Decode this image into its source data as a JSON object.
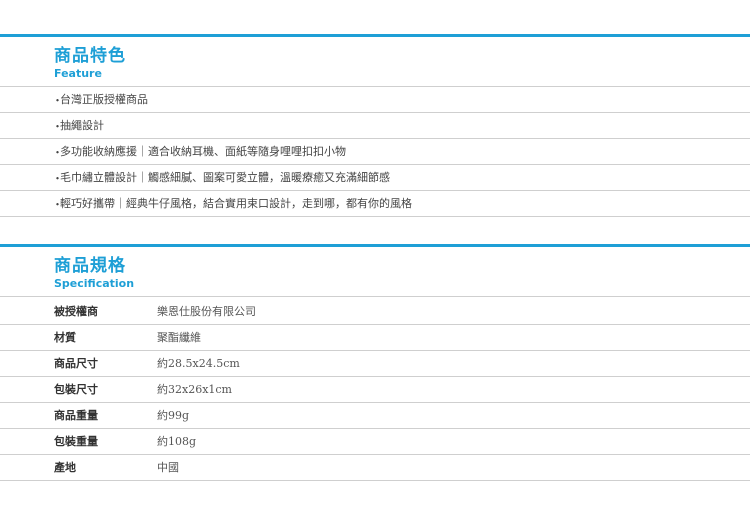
{
  "feature": {
    "title": "商品特色",
    "subtitle": "Feature",
    "items": [
      "台灣正版授權商品",
      "抽繩設計",
      "多功能收納應援｜適合收納耳機、面紙等隨身哩哩扣扣小物",
      "毛巾繡立體設計｜觸感細膩、圖案可愛立體，溫暖療癒又充滿細節感",
      "輕巧好攜帶｜經典牛仔風格，結合實用束口設計，走到哪，都有你的風格"
    ],
    "bullet": "・"
  },
  "spec": {
    "title": "商品規格",
    "subtitle": "Specification",
    "rows": [
      {
        "label": "被授權商",
        "value": "樂恩仕股份有限公司"
      },
      {
        "label": "材質",
        "value": "聚酯纖維"
      },
      {
        "label": "商品尺寸",
        "value": "約28.5x24.5cm"
      },
      {
        "label": "包裝尺寸",
        "value": "約32x26x1cm"
      },
      {
        "label": "商品重量",
        "value": "約99g"
      },
      {
        "label": "包裝重量",
        "value": "約108g"
      },
      {
        "label": "產地",
        "value": "中國"
      }
    ]
  },
  "colors": {
    "accent": "#1e9fd6",
    "divider": "#cfcfcf"
  }
}
